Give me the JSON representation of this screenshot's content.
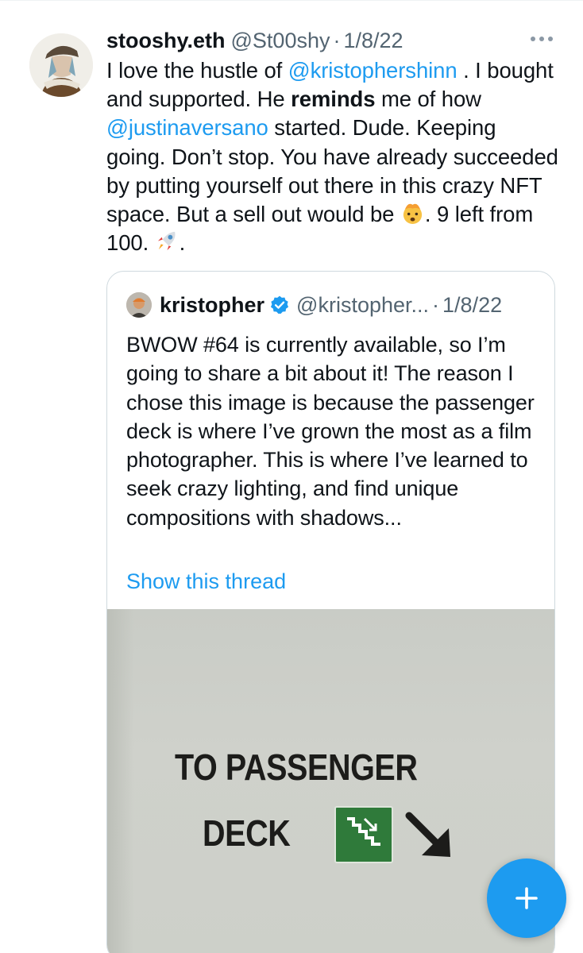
{
  "tweet": {
    "author": {
      "display_name": "stooshy.eth",
      "handle": "@St00shy",
      "avatar": "avatar-illustrated-character"
    },
    "separator": "·",
    "date": "1/8/22",
    "more_icon": "more-horizontal-icon",
    "text": {
      "p1": "I love the hustle of ",
      "mention1": "@kristophershinn",
      "p2": " . I bought and supported. He ",
      "bold": "reminds",
      "p3": " me of how ",
      "mention2": "@justinaversano",
      "p4": " started. Dude. Keeping going. Don’t stop. You have already succeeded by putting yourself out there in this crazy NFT space. But a sell out would be ",
      "emoji1": "exploding-head-emoji",
      "p5": ". 9 left from 100. ",
      "emoji2": "rocket-emoji",
      "p6": "."
    }
  },
  "quote": {
    "author": {
      "display_name": "kristopher",
      "verified_icon": "verified-badge-icon",
      "handle": "@kristopher...",
      "avatar": "avatar-photo"
    },
    "separator": "·",
    "date": "1/8/22",
    "text": "BWOW #64 is currently available, so I’m going to share a bit about it! The reason I chose this image is because the passenger deck is where I’ve grown the most as a film photographer. This is where I’ve learned to seek crazy lighting, and find unique compositions with shadows...",
    "show_thread": "Show this thread",
    "image": {
      "sign_line1": "TO PASSENGER",
      "sign_line2": "DECK",
      "stairs_icon": "stairs-down-icon",
      "arrow_icon": "arrow-down-right-icon"
    }
  },
  "compose_button": {
    "icon": "plus-icon"
  },
  "colors": {
    "accent": "#1d9bf0",
    "text": "#0f1419",
    "secondary": "#536471"
  }
}
